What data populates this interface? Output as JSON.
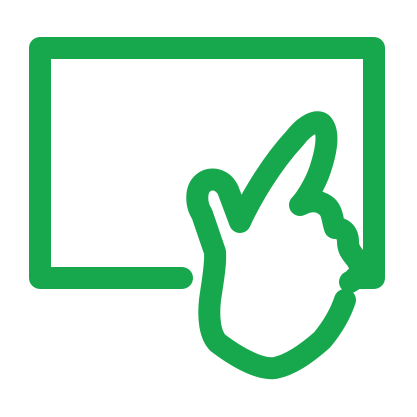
{
  "icon": {
    "name": "touchscreen-gesture-icon",
    "color": "#17a84d",
    "background": "#ffffff"
  }
}
